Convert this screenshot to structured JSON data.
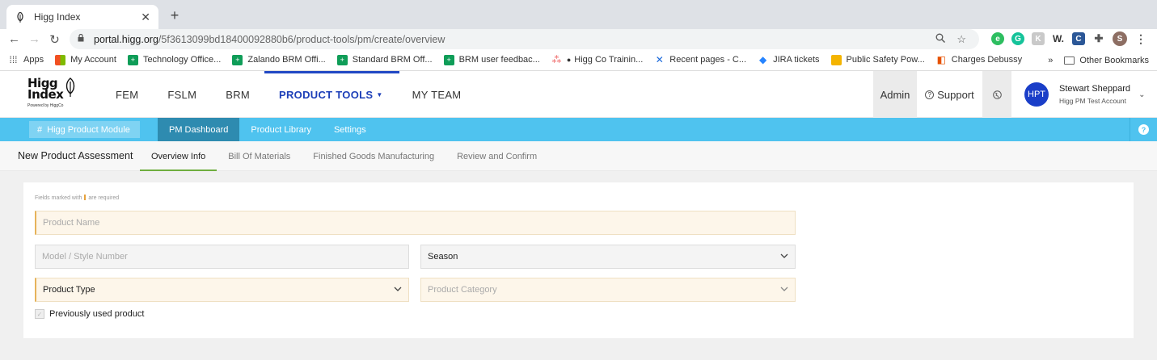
{
  "browser": {
    "tab_title": "Higg Index",
    "url_host": "portal.higg.org",
    "url_path": "/5f3613099bd18400092880b6/product-tools/pm/create/overview",
    "bookmarks": [
      {
        "label": "Apps",
        "icon": "apps-grid-icon"
      },
      {
        "label": "My Account",
        "icon": "microsoft-icon"
      },
      {
        "label": "Technology Office...",
        "icon": "sheets-icon"
      },
      {
        "label": "Zalando BRM Offi...",
        "icon": "sheets-icon"
      },
      {
        "label": "Standard BRM Off...",
        "icon": "sheets-icon"
      },
      {
        "label": "BRM user feedbac...",
        "icon": "sheets-icon"
      },
      {
        "label": "Higg Co Trainin...",
        "icon": "asana-icon"
      },
      {
        "label": "Recent pages - C...",
        "icon": "confluence-icon"
      },
      {
        "label": "JIRA tickets",
        "icon": "jira-icon"
      },
      {
        "label": "Public Safety Pow...",
        "icon": "slides-icon"
      },
      {
        "label": "Charges Debussy",
        "icon": "charges-icon"
      }
    ],
    "more_bookmarks": "»",
    "other_bookmarks": "Other Bookmarks",
    "profile_initial": "S"
  },
  "header": {
    "logo_line1": "Higg",
    "logo_line2": "Index",
    "logo_tagline": "Powered by HiggCo",
    "nav": [
      {
        "label": "FEM"
      },
      {
        "label": "FSLM"
      },
      {
        "label": "BRM"
      },
      {
        "label": "PRODUCT TOOLS"
      },
      {
        "label": "MY TEAM"
      }
    ],
    "admin_label": "Admin",
    "support_label": "Support",
    "user_initials": "HPT",
    "user_name": "Stewart Sheppard",
    "user_account": "Higg PM Test Account"
  },
  "module_bar": {
    "module_name": "Higg Product Module",
    "tabs": [
      {
        "label": "PM Dashboard"
      },
      {
        "label": "Product Library"
      },
      {
        "label": "Settings"
      }
    ],
    "help": "?"
  },
  "assessment": {
    "heading": "New Product Assessment",
    "steps": [
      {
        "label": "Overview Info"
      },
      {
        "label": "Bill Of Materials"
      },
      {
        "label": "Finished Goods Manufacturing"
      },
      {
        "label": "Review and Confirm"
      }
    ]
  },
  "form": {
    "required_note_prefix": "Fields marked with",
    "required_note_suffix": "are required",
    "product_name_placeholder": "Product Name",
    "model_placeholder": "Model / Style Number",
    "season_value": "Season",
    "product_type_value": "Product Type",
    "product_category_placeholder": "Product Category",
    "previously_used_label": "Previously used product"
  },
  "colors": {
    "accent_blue": "#2148c4",
    "module_bar": "#4fc3ef",
    "active_module_tab": "#2e8bb0",
    "active_step_underline": "#6fae3f",
    "required_field_bg": "#fdf6ea"
  }
}
